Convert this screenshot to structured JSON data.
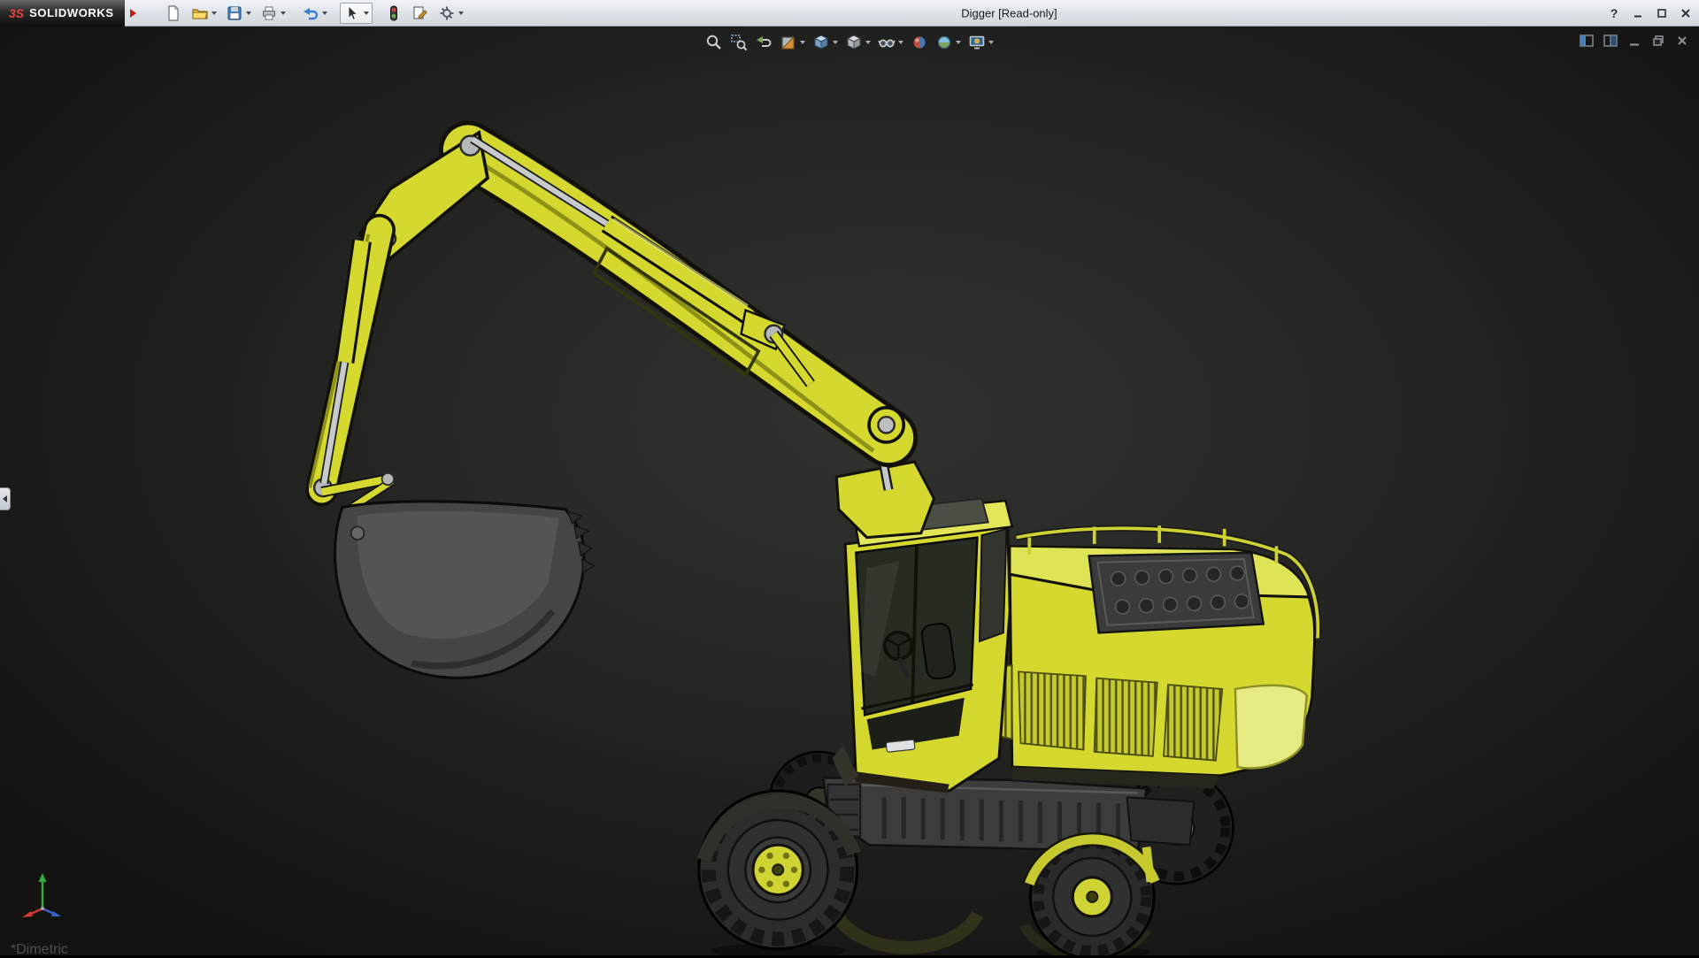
{
  "window": {
    "brand_logo": "3S",
    "brand": "SOLIDWORKS",
    "title": "Digger [Read-only]",
    "help_glyph": "?"
  },
  "main_toolbar": {
    "items": [
      {
        "icon": "new-document-icon",
        "dropdown": false
      },
      {
        "icon": "open-folder-icon",
        "dropdown": true
      },
      {
        "icon": "save-icon",
        "dropdown": true
      },
      {
        "icon": "print-icon",
        "dropdown": true
      },
      {
        "icon": "undo-icon",
        "dropdown": true
      },
      {
        "icon": "select-cursor-icon",
        "dropdown": true
      },
      {
        "icon": "rebuild-stoplight-icon",
        "dropdown": false
      },
      {
        "icon": "sheet-pencil-icon",
        "dropdown": false
      },
      {
        "icon": "options-gear-icon",
        "dropdown": true
      }
    ]
  },
  "heads_up_toolbar": {
    "items": [
      {
        "icon": "zoom-to-fit-icon",
        "dropdown": false
      },
      {
        "icon": "zoom-to-area-icon",
        "dropdown": false
      },
      {
        "icon": "previous-view-icon",
        "dropdown": false
      },
      {
        "icon": "section-view-icon",
        "dropdown": true
      },
      {
        "icon": "view-orientation-icon",
        "dropdown": true
      },
      {
        "icon": "display-style-icon",
        "dropdown": true
      },
      {
        "icon": "hide-show-items-icon",
        "dropdown": true
      },
      {
        "icon": "edit-appearance-icon",
        "dropdown": false
      },
      {
        "icon": "apply-scene-icon",
        "dropdown": true
      },
      {
        "icon": "view-settings-icon",
        "dropdown": true
      }
    ]
  },
  "document_controls": {
    "icons": [
      "pane-preview-icon",
      "pane-split-icon",
      "minimize-document-icon",
      "restore-document-icon",
      "close-document-icon"
    ]
  },
  "viewport": {
    "orientation_label": "*Dimetric",
    "model_name": "Digger excavator 3D model"
  },
  "colors": {
    "body-yellow": "#d4d82f",
    "body-yellow-light": "#e2e658",
    "body-yellow-dark": "#9b9e1d",
    "edge-dark": "#12120a",
    "metal-gray": "#c6c8ca",
    "dark-part": "#3c3c3c",
    "tire-dark": "#2b2b2b",
    "glass-dark": "#272c23",
    "titlebar-bg": "#dde2e7",
    "brand-red": "#d8342c",
    "viewport-dark": "#1a1a19"
  }
}
